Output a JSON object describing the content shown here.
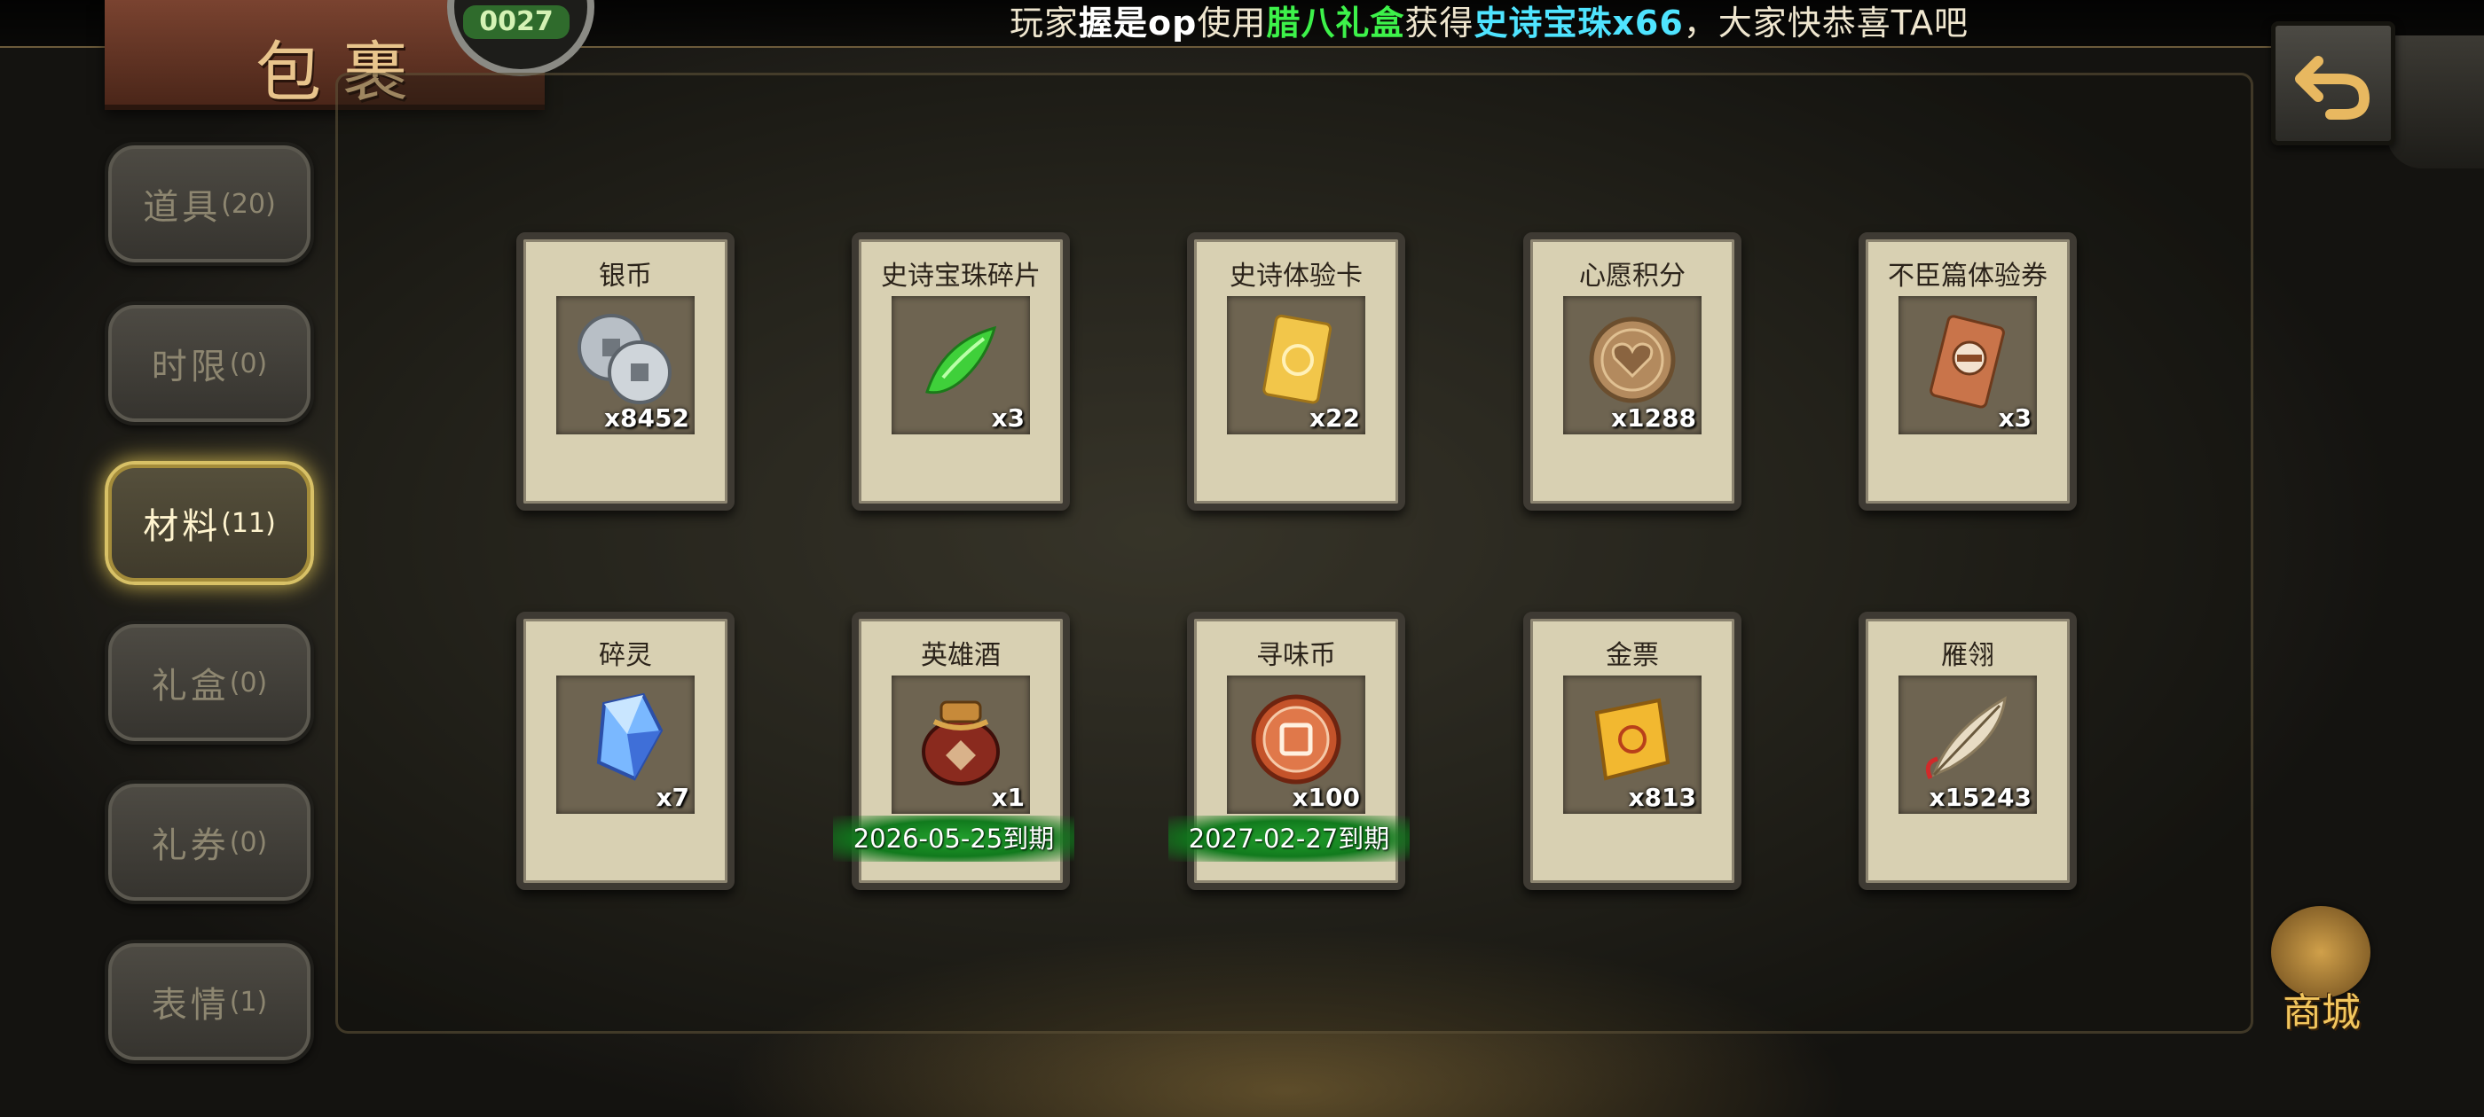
{
  "announcement": {
    "prefix": "玩家",
    "player": "握是op",
    "mid1": "使用",
    "item_used": "腊八礼盒",
    "mid2": "获得",
    "reward": "史诗宝珠x66",
    "suffix": "，大家快恭喜TA吧"
  },
  "header": {
    "title": "包裹",
    "badge": "0027"
  },
  "tabs": [
    {
      "label": "道具",
      "count": "(20)",
      "active": false
    },
    {
      "label": "时限",
      "count": "(0)",
      "active": false
    },
    {
      "label": "材料",
      "count": "(11)",
      "active": true
    },
    {
      "label": "礼盒",
      "count": "(0)",
      "active": false
    },
    {
      "label": "礼券",
      "count": "(0)",
      "active": false
    },
    {
      "label": "表情",
      "count": "(1)",
      "active": false
    }
  ],
  "items": [
    {
      "name": "银币",
      "qty": "x8452",
      "icon": "silver-coins-icon"
    },
    {
      "name": "史诗宝珠碎片",
      "qty": "x3",
      "icon": "green-jade-shard-icon"
    },
    {
      "name": "史诗体验卡",
      "qty": "x22",
      "icon": "gold-card-icon"
    },
    {
      "name": "心愿积分",
      "qty": "x1288",
      "icon": "heart-coin-icon"
    },
    {
      "name": "不臣篇体验券",
      "qty": "x3",
      "icon": "bronze-ticket-icon"
    },
    {
      "name": "碎灵",
      "qty": "x7",
      "icon": "blue-crystal-icon"
    },
    {
      "name": "英雄酒",
      "qty": "x1",
      "icon": "wine-jar-icon",
      "expiry": "2026-05-25到期"
    },
    {
      "name": "寻味币",
      "qty": "x100",
      "icon": "flavor-coin-icon",
      "expiry": "2027-02-27到期"
    },
    {
      "name": "金票",
      "qty": "x813",
      "icon": "gold-scroll-icon"
    },
    {
      "name": "雁翎",
      "qty": "x15243",
      "icon": "feather-icon"
    }
  ],
  "shop": {
    "label": "商城"
  },
  "colors": {
    "announce_green": "#3df24a",
    "announce_cyan": "#4fe4ff",
    "active_tab_glow": "#d8c166",
    "expiry_green": "#1a8c26",
    "card_bg": "#d8d0b2"
  }
}
